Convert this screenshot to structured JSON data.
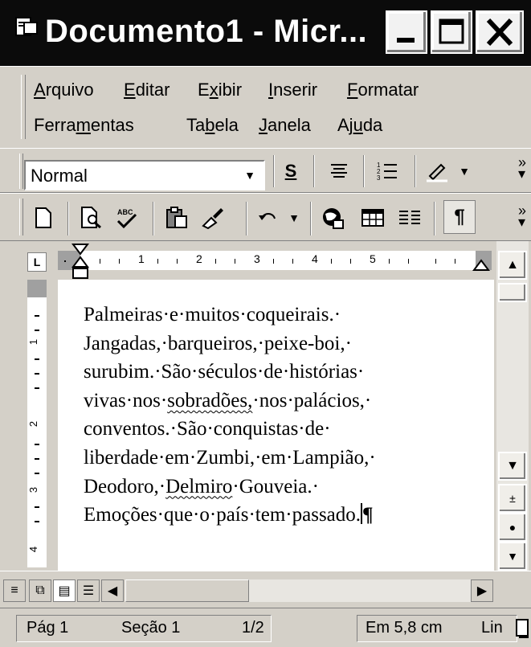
{
  "window": {
    "title": "Documento1 - Micr...",
    "buttons": {
      "minimize": "minimize-icon",
      "maximize": "maximize-icon",
      "close": "close-icon"
    }
  },
  "menu": {
    "row1": [
      {
        "label_pre": "",
        "mnemonic": "A",
        "label_post": "rquivo"
      },
      {
        "label_pre": "",
        "mnemonic": "E",
        "label_post": "ditar"
      },
      {
        "label_pre": "E",
        "mnemonic": "x",
        "label_post": "ibir"
      },
      {
        "label_pre": "",
        "mnemonic": "I",
        "label_post": "nserir"
      },
      {
        "label_pre": "",
        "mnemonic": "F",
        "label_post": "ormatar"
      }
    ],
    "row2": [
      {
        "label_pre": "Ferra",
        "mnemonic": "m",
        "label_post": "entas"
      },
      {
        "label_pre": "Ta",
        "mnemonic": "b",
        "label_post": "ela"
      },
      {
        "label_pre": "",
        "mnemonic": "J",
        "label_post": "anela"
      },
      {
        "label_pre": "Aj",
        "mnemonic": "u",
        "label_post": "da"
      }
    ]
  },
  "formatting_toolbar": {
    "style_value": "Normal",
    "buttons": [
      "strikethrough-s-icon",
      "align-icon",
      "numbered-list-icon",
      "highlight-pen-icon"
    ],
    "strike_label": "S"
  },
  "standard_toolbar": {
    "buttons": [
      "new-document-icon",
      "print-preview-icon",
      "spelling-icon",
      "paste-icon",
      "format-painter-icon",
      "undo-icon",
      "web-icon",
      "insert-table-icon",
      "columns-icon",
      "show-formatting-icon"
    ],
    "pilcrow": "¶"
  },
  "ruler": {
    "tab_symbol": "L",
    "numbers": [
      "1",
      "2",
      "3",
      "4",
      "5"
    ]
  },
  "vertical_ruler": {
    "numbers": [
      "1",
      "2",
      "3",
      "4"
    ]
  },
  "document": {
    "lines": [
      "Palmeiras·e·muitos·coqueirais.·",
      "Jangadas,·barqueiros,·peixe-boi,·",
      "surubim.·São·séculos·de·histórias·",
      "vivas·nos·",
      "sobradões,",
      "·nos·palácios,·",
      "conventos.·São·conquistas·de·",
      "liberdade·em·Zumbi,·em·Lampião,·",
      "Deodoro,·",
      "Delmiro",
      "·Gouveia.·",
      "Emoções·que·o·país·tem·passado.",
      "¶"
    ]
  },
  "status": {
    "page": "Pág 1",
    "section": "Seção 1",
    "pages": "1/2",
    "position": "Em 5,8 cm",
    "line": "Lin"
  }
}
